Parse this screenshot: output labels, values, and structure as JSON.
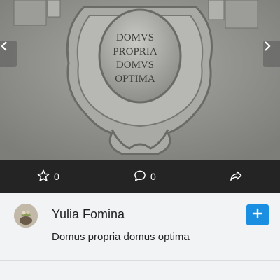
{
  "photo": {
    "inscription_lines": [
      "DOMVS",
      "PROPRIA",
      "DOMVS",
      "OPTIMA"
    ]
  },
  "actions": {
    "likes_count": "0",
    "comments_count": "0"
  },
  "post": {
    "author": "Yulia Fomina",
    "caption": "Domus propria domus optima"
  },
  "colors": {
    "action_bar": "#242424",
    "follow_button": "#1a8ee0",
    "background": "#f2f3f5"
  },
  "icons": [
    "chevron-left-icon",
    "chevron-right-icon",
    "star-icon",
    "comment-icon",
    "share-icon",
    "plus-icon"
  ]
}
